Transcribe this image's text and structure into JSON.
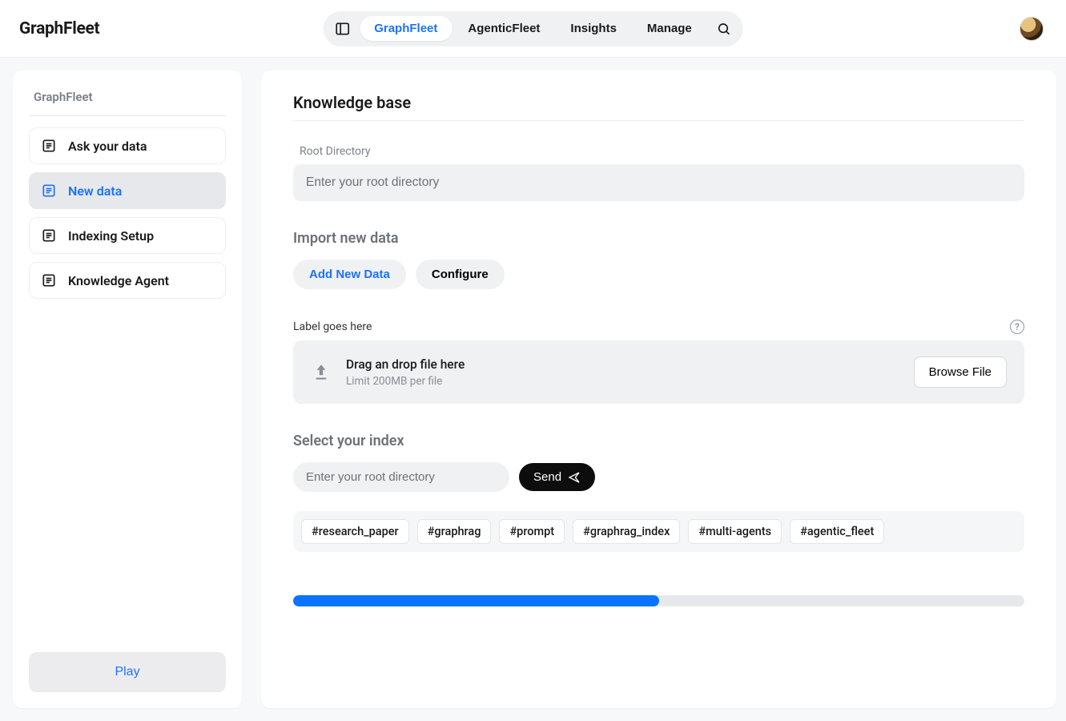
{
  "brand": "GraphFleet",
  "nav": {
    "items": [
      {
        "label": "GraphFleet",
        "active": true
      },
      {
        "label": "AgenticFleet",
        "active": false
      },
      {
        "label": "Insights",
        "active": false
      },
      {
        "label": "Manage",
        "active": false
      }
    ]
  },
  "sidebar": {
    "title": "GraphFleet",
    "items": [
      {
        "label": "Ask your data",
        "active": false
      },
      {
        "label": "New data",
        "active": true
      },
      {
        "label": "Indexing Setup",
        "active": false
      },
      {
        "label": "Knowledge Agent",
        "active": false
      }
    ],
    "play_label": "Play"
  },
  "main": {
    "page_title": "Knowledge base",
    "root_dir": {
      "label": "Root Directory",
      "placeholder": "Enter your root directory",
      "value": ""
    },
    "import_heading": "Import new data",
    "add_new_data_label": "Add New Data",
    "configure_label": "Configure",
    "file_section_label": "Label goes here",
    "dropzone": {
      "title": "Drag an drop file here",
      "sub": "Limit 200MB per file",
      "browse_label": "Browse File"
    },
    "select_index_heading": "Select your index",
    "index_input_placeholder": "Enter your root directory",
    "send_label": "Send",
    "tags": [
      "#research_paper",
      "#graphrag",
      "#prompt",
      "#graphrag_index",
      "#multi-agents",
      "#agentic_fleet"
    ],
    "progress_percent": 50
  }
}
